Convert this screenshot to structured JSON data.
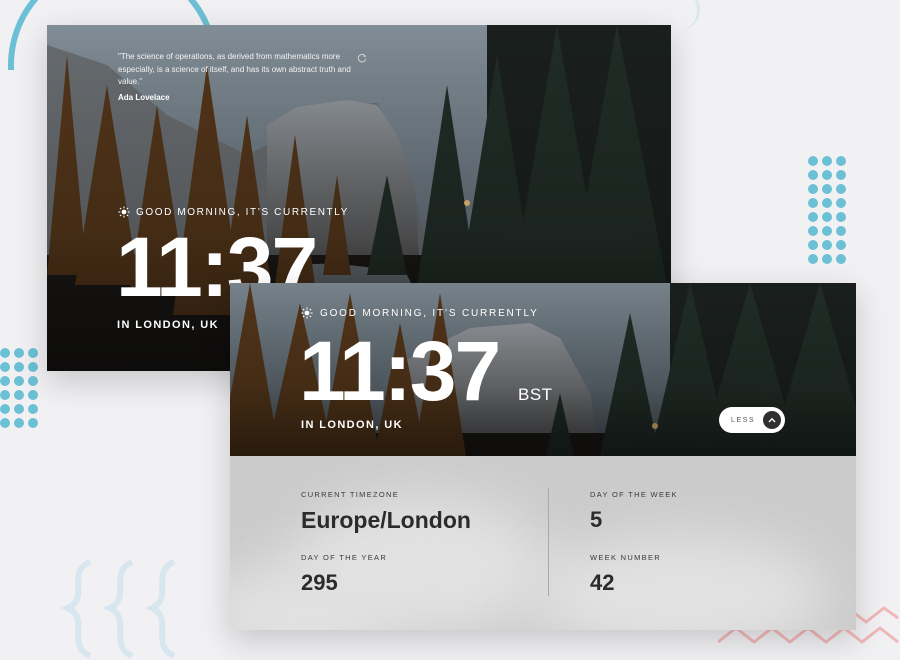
{
  "colors": {
    "accent": "#6cc0d6",
    "zigzag": "#f2b8b8",
    "panel": "#cbcbcb"
  },
  "top_card": {
    "quote_text": "\"The science of operations, as derived from mathematics more especially, is a science of itself, and has its own abstract truth and value.\"",
    "quote_author": "Ada Lovelace",
    "refresh_icon": "refresh-icon",
    "greeting": "GOOD MORNING, IT’S CURRENTLY",
    "greeting_icon": "sun-icon",
    "time": "11:37",
    "location": "IN LONDON, UK"
  },
  "main_card": {
    "greeting": "GOOD MORNING, IT’S CURRENTLY",
    "greeting_icon": "sun-icon",
    "time": "11:37",
    "zone_abbr": "BST",
    "location": "IN LONDON, UK",
    "toggle_label": "LESS",
    "toggle_icon": "chevron-up-icon",
    "details": {
      "timezone_label": "CURRENT TIMEZONE",
      "timezone_value": "Europe/London",
      "day_of_year_label": "DAY OF THE YEAR",
      "day_of_year_value": "295",
      "day_of_week_label": "DAY OF THE WEEK",
      "day_of_week_value": "5",
      "week_number_label": "WEEK NUMBER",
      "week_number_value": "42"
    }
  }
}
